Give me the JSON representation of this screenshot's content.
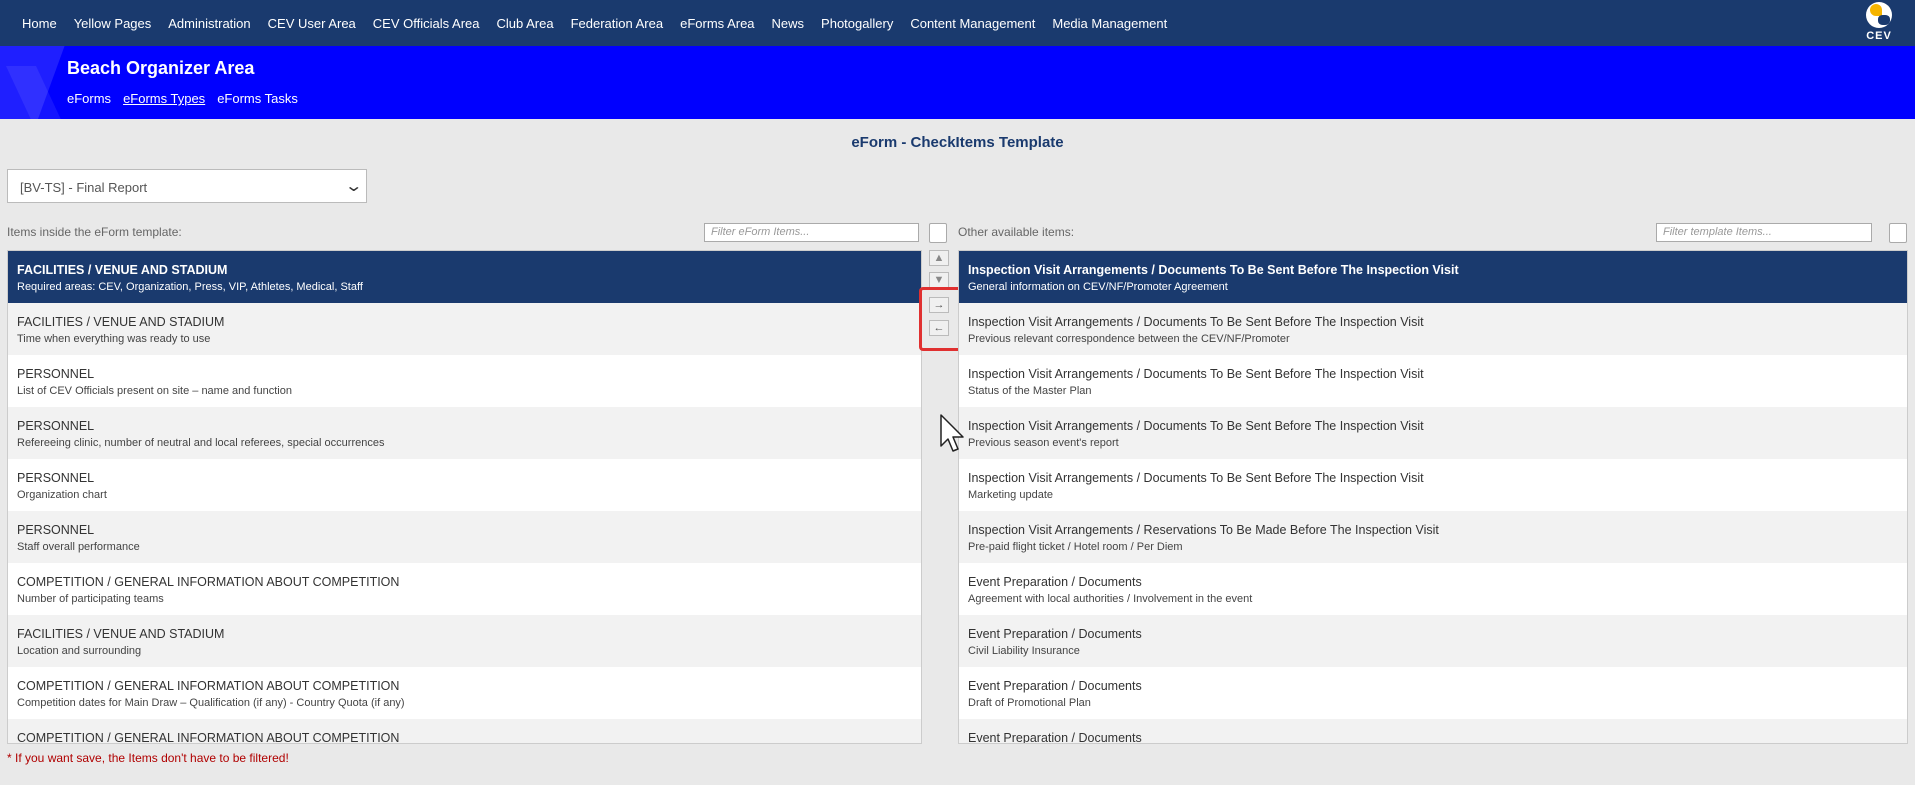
{
  "topnav": {
    "items": [
      "Home",
      "Yellow Pages",
      "Administration",
      "CEV User Area",
      "CEV Officials Area",
      "Club Area",
      "Federation Area",
      "eForms Area",
      "News",
      "Photogallery",
      "Content Management",
      "Media Management"
    ],
    "logo_text": "CEV"
  },
  "area": {
    "title": "Beach Organizer Area",
    "tabs": [
      "eForms",
      "eForms Types",
      "eForms Tasks"
    ],
    "active_tab": "eForms Types"
  },
  "page_title": "eForm - CheckItems Template",
  "template_select": {
    "value": "[BV-TS] - Final Report"
  },
  "left_panel": {
    "label": "Items inside the eForm template:",
    "filter_placeholder": "Filter eForm Items...",
    "items": [
      {
        "title": "FACILITIES / VENUE AND STADIUM",
        "sub": "Required areas: CEV, Organization, Press, VIP, Athletes, Medical, Staff",
        "selected": true
      },
      {
        "title": "FACILITIES / VENUE AND STADIUM",
        "sub": "Time when everything was ready to use"
      },
      {
        "title": "PERSONNEL",
        "sub": "List of CEV Officials present on site – name and function"
      },
      {
        "title": "PERSONNEL",
        "sub": "Refereeing clinic, number of neutral and local referees, special occurrences"
      },
      {
        "title": "PERSONNEL",
        "sub": "Organization chart"
      },
      {
        "title": "PERSONNEL",
        "sub": "Staff overall performance"
      },
      {
        "title": "COMPETITION / GENERAL INFORMATION ABOUT COMPETITION",
        "sub": "Number of participating teams"
      },
      {
        "title": "FACILITIES / VENUE AND STADIUM",
        "sub": "Location and surrounding"
      },
      {
        "title": "COMPETITION / GENERAL INFORMATION ABOUT COMPETITION",
        "sub": "Competition dates for Main Draw – Qualification (if any) - Country Quota (if any)"
      },
      {
        "title": "COMPETITION / GENERAL INFORMATION ABOUT COMPETITION",
        "sub": ""
      }
    ]
  },
  "right_panel": {
    "label": "Other available items:",
    "filter_placeholder": "Filter template Items...",
    "items": [
      {
        "title": "Inspection Visit Arrangements / Documents To Be Sent Before The Inspection Visit",
        "sub": "General information on CEV/NF/Promoter Agreement",
        "selected": true
      },
      {
        "title": "Inspection Visit Arrangements / Documents To Be Sent Before The Inspection Visit",
        "sub": "Previous relevant correspondence between the CEV/NF/Promoter"
      },
      {
        "title": "Inspection Visit Arrangements / Documents To Be Sent Before The Inspection Visit",
        "sub": "Status of the Master Plan"
      },
      {
        "title": "Inspection Visit Arrangements / Documents To Be Sent Before The Inspection Visit",
        "sub": "Previous season event's report"
      },
      {
        "title": "Inspection Visit Arrangements / Documents To Be Sent Before The Inspection Visit",
        "sub": "Marketing update"
      },
      {
        "title": "Inspection Visit Arrangements / Reservations To Be Made Before The Inspection Visit",
        "sub": "Pre-paid flight ticket / Hotel room / Per Diem"
      },
      {
        "title": "Event Preparation / Documents",
        "sub": "Agreement with local authorities / Involvement in the event"
      },
      {
        "title": "Event Preparation / Documents",
        "sub": "Civil Liability Insurance"
      },
      {
        "title": "Event Preparation / Documents",
        "sub": "Draft of Promotional Plan"
      },
      {
        "title": "Event Preparation / Documents",
        "sub": ""
      }
    ]
  },
  "controls": {
    "move_up": "▲",
    "move_down": "▼",
    "move_right": "→",
    "move_left": "←"
  },
  "note": "* If you want save, the Items don't have to be filtered!"
}
